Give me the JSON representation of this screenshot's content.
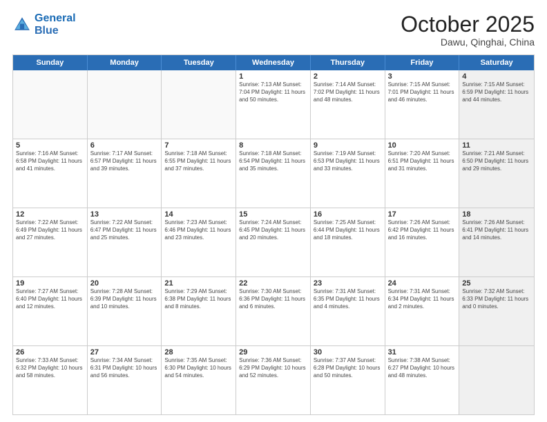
{
  "header": {
    "logo_line1": "General",
    "logo_line2": "Blue",
    "title": "October 2025",
    "subtitle": "Dawu, Qinghai, China"
  },
  "days_of_week": [
    "Sunday",
    "Monday",
    "Tuesday",
    "Wednesday",
    "Thursday",
    "Friday",
    "Saturday"
  ],
  "weeks": [
    [
      {
        "num": "",
        "info": "",
        "empty": true
      },
      {
        "num": "",
        "info": "",
        "empty": true
      },
      {
        "num": "",
        "info": "",
        "empty": true
      },
      {
        "num": "1",
        "info": "Sunrise: 7:13 AM\nSunset: 7:04 PM\nDaylight: 11 hours\nand 50 minutes.",
        "empty": false
      },
      {
        "num": "2",
        "info": "Sunrise: 7:14 AM\nSunset: 7:02 PM\nDaylight: 11 hours\nand 48 minutes.",
        "empty": false
      },
      {
        "num": "3",
        "info": "Sunrise: 7:15 AM\nSunset: 7:01 PM\nDaylight: 11 hours\nand 46 minutes.",
        "empty": false
      },
      {
        "num": "4",
        "info": "Sunrise: 7:15 AM\nSunset: 6:59 PM\nDaylight: 11 hours\nand 44 minutes.",
        "empty": false,
        "shaded": true
      }
    ],
    [
      {
        "num": "5",
        "info": "Sunrise: 7:16 AM\nSunset: 6:58 PM\nDaylight: 11 hours\nand 41 minutes.",
        "empty": false
      },
      {
        "num": "6",
        "info": "Sunrise: 7:17 AM\nSunset: 6:57 PM\nDaylight: 11 hours\nand 39 minutes.",
        "empty": false
      },
      {
        "num": "7",
        "info": "Sunrise: 7:18 AM\nSunset: 6:55 PM\nDaylight: 11 hours\nand 37 minutes.",
        "empty": false
      },
      {
        "num": "8",
        "info": "Sunrise: 7:18 AM\nSunset: 6:54 PM\nDaylight: 11 hours\nand 35 minutes.",
        "empty": false
      },
      {
        "num": "9",
        "info": "Sunrise: 7:19 AM\nSunset: 6:53 PM\nDaylight: 11 hours\nand 33 minutes.",
        "empty": false
      },
      {
        "num": "10",
        "info": "Sunrise: 7:20 AM\nSunset: 6:51 PM\nDaylight: 11 hours\nand 31 minutes.",
        "empty": false
      },
      {
        "num": "11",
        "info": "Sunrise: 7:21 AM\nSunset: 6:50 PM\nDaylight: 11 hours\nand 29 minutes.",
        "empty": false,
        "shaded": true
      }
    ],
    [
      {
        "num": "12",
        "info": "Sunrise: 7:22 AM\nSunset: 6:49 PM\nDaylight: 11 hours\nand 27 minutes.",
        "empty": false
      },
      {
        "num": "13",
        "info": "Sunrise: 7:22 AM\nSunset: 6:47 PM\nDaylight: 11 hours\nand 25 minutes.",
        "empty": false
      },
      {
        "num": "14",
        "info": "Sunrise: 7:23 AM\nSunset: 6:46 PM\nDaylight: 11 hours\nand 23 minutes.",
        "empty": false
      },
      {
        "num": "15",
        "info": "Sunrise: 7:24 AM\nSunset: 6:45 PM\nDaylight: 11 hours\nand 20 minutes.",
        "empty": false
      },
      {
        "num": "16",
        "info": "Sunrise: 7:25 AM\nSunset: 6:44 PM\nDaylight: 11 hours\nand 18 minutes.",
        "empty": false
      },
      {
        "num": "17",
        "info": "Sunrise: 7:26 AM\nSunset: 6:42 PM\nDaylight: 11 hours\nand 16 minutes.",
        "empty": false
      },
      {
        "num": "18",
        "info": "Sunrise: 7:26 AM\nSunset: 6:41 PM\nDaylight: 11 hours\nand 14 minutes.",
        "empty": false,
        "shaded": true
      }
    ],
    [
      {
        "num": "19",
        "info": "Sunrise: 7:27 AM\nSunset: 6:40 PM\nDaylight: 11 hours\nand 12 minutes.",
        "empty": false
      },
      {
        "num": "20",
        "info": "Sunrise: 7:28 AM\nSunset: 6:39 PM\nDaylight: 11 hours\nand 10 minutes.",
        "empty": false
      },
      {
        "num": "21",
        "info": "Sunrise: 7:29 AM\nSunset: 6:38 PM\nDaylight: 11 hours\nand 8 minutes.",
        "empty": false
      },
      {
        "num": "22",
        "info": "Sunrise: 7:30 AM\nSunset: 6:36 PM\nDaylight: 11 hours\nand 6 minutes.",
        "empty": false
      },
      {
        "num": "23",
        "info": "Sunrise: 7:31 AM\nSunset: 6:35 PM\nDaylight: 11 hours\nand 4 minutes.",
        "empty": false
      },
      {
        "num": "24",
        "info": "Sunrise: 7:31 AM\nSunset: 6:34 PM\nDaylight: 11 hours\nand 2 minutes.",
        "empty": false
      },
      {
        "num": "25",
        "info": "Sunrise: 7:32 AM\nSunset: 6:33 PM\nDaylight: 11 hours\nand 0 minutes.",
        "empty": false,
        "shaded": true
      }
    ],
    [
      {
        "num": "26",
        "info": "Sunrise: 7:33 AM\nSunset: 6:32 PM\nDaylight: 10 hours\nand 58 minutes.",
        "empty": false
      },
      {
        "num": "27",
        "info": "Sunrise: 7:34 AM\nSunset: 6:31 PM\nDaylight: 10 hours\nand 56 minutes.",
        "empty": false
      },
      {
        "num": "28",
        "info": "Sunrise: 7:35 AM\nSunset: 6:30 PM\nDaylight: 10 hours\nand 54 minutes.",
        "empty": false
      },
      {
        "num": "29",
        "info": "Sunrise: 7:36 AM\nSunset: 6:29 PM\nDaylight: 10 hours\nand 52 minutes.",
        "empty": false
      },
      {
        "num": "30",
        "info": "Sunrise: 7:37 AM\nSunset: 6:28 PM\nDaylight: 10 hours\nand 50 minutes.",
        "empty": false
      },
      {
        "num": "31",
        "info": "Sunrise: 7:38 AM\nSunset: 6:27 PM\nDaylight: 10 hours\nand 48 minutes.",
        "empty": false
      },
      {
        "num": "",
        "info": "",
        "empty": true,
        "shaded": true
      }
    ]
  ]
}
